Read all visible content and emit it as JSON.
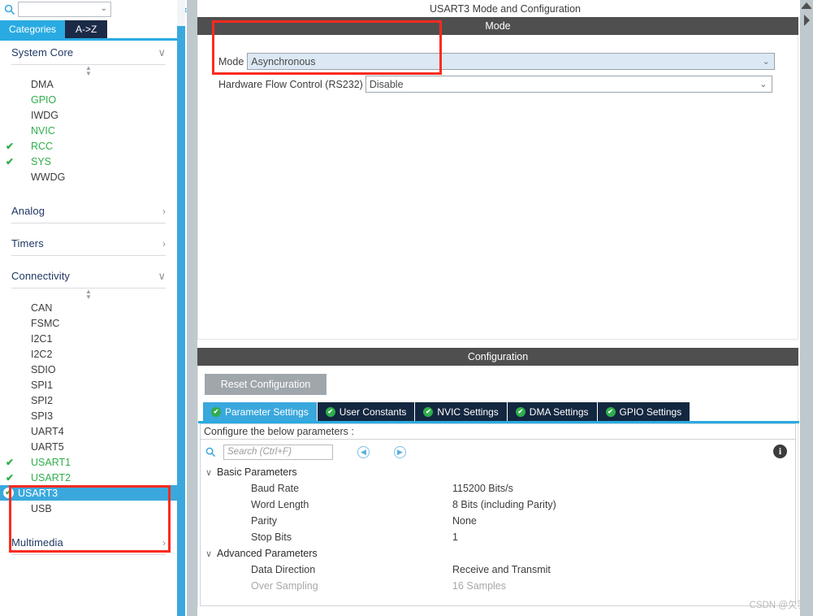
{
  "sidebar": {
    "search": {
      "value": "",
      "placeholder": ""
    },
    "search_icon": "search-icon",
    "gear_icon": "gear-icon",
    "tabs": [
      {
        "label": "Categories",
        "active": true
      },
      {
        "label": "A->Z",
        "active": false
      }
    ],
    "groups": [
      {
        "name": "System Core",
        "expanded": true,
        "arrow": "∨",
        "items": [
          {
            "label": "DMA",
            "checked": false,
            "green": false,
            "selected": false
          },
          {
            "label": "GPIO",
            "checked": false,
            "green": true,
            "selected": false
          },
          {
            "label": "IWDG",
            "checked": false,
            "green": false,
            "selected": false
          },
          {
            "label": "NVIC",
            "checked": false,
            "green": true,
            "selected": false
          },
          {
            "label": "RCC",
            "checked": true,
            "green": true,
            "selected": false
          },
          {
            "label": "SYS",
            "checked": true,
            "green": true,
            "selected": false
          },
          {
            "label": "WWDG",
            "checked": false,
            "green": false,
            "selected": false
          }
        ]
      },
      {
        "name": "Analog",
        "expanded": false,
        "arrow": "›",
        "items": []
      },
      {
        "name": "Timers",
        "expanded": false,
        "arrow": "›",
        "items": []
      },
      {
        "name": "Connectivity",
        "expanded": true,
        "arrow": "∨",
        "items": [
          {
            "label": "CAN",
            "checked": false,
            "green": false,
            "selected": false
          },
          {
            "label": "FSMC",
            "checked": false,
            "green": false,
            "selected": false
          },
          {
            "label": "I2C1",
            "checked": false,
            "green": false,
            "selected": false
          },
          {
            "label": "I2C2",
            "checked": false,
            "green": false,
            "selected": false
          },
          {
            "label": "SDIO",
            "checked": false,
            "green": false,
            "selected": false
          },
          {
            "label": "SPI1",
            "checked": false,
            "green": false,
            "selected": false
          },
          {
            "label": "SPI2",
            "checked": false,
            "green": false,
            "selected": false
          },
          {
            "label": "SPI3",
            "checked": false,
            "green": false,
            "selected": false
          },
          {
            "label": "UART4",
            "checked": false,
            "green": false,
            "selected": false
          },
          {
            "label": "UART5",
            "checked": false,
            "green": false,
            "selected": false
          },
          {
            "label": "USART1",
            "checked": true,
            "green": true,
            "selected": false
          },
          {
            "label": "USART2",
            "checked": true,
            "green": true,
            "selected": false
          },
          {
            "label": "USART3",
            "checked": true,
            "green": true,
            "selected": true
          },
          {
            "label": "USB",
            "checked": false,
            "green": false,
            "selected": false
          }
        ]
      },
      {
        "name": "Multimedia",
        "expanded": false,
        "arrow": "›",
        "items": []
      }
    ]
  },
  "right": {
    "page_title": "USART3 Mode and Configuration",
    "mode_section": {
      "band": "Mode",
      "fields": [
        {
          "label": "Mode",
          "value": "Asynchronous",
          "style": "active"
        },
        {
          "label": "Hardware Flow Control (RS232)",
          "value": "Disable",
          "style": "plain"
        }
      ]
    },
    "config_section": {
      "band": "Configuration",
      "reset_label": "Reset Configuration",
      "tabs": [
        {
          "label": "Parameter Settings",
          "active": true
        },
        {
          "label": "User Constants",
          "active": false
        },
        {
          "label": "NVIC Settings",
          "active": false
        },
        {
          "label": "DMA Settings",
          "active": false
        },
        {
          "label": "GPIO Settings",
          "active": false
        }
      ],
      "configure_hint": "Configure the below parameters :",
      "search": {
        "value": "",
        "placeholder": "Search (Ctrl+F)"
      },
      "nav_prev_icon": "chevron-left-circle-icon",
      "nav_next_icon": "chevron-right-circle-icon",
      "info_icon": "info-icon",
      "param_groups": [
        {
          "name": "Basic Parameters",
          "arrow": "∨",
          "rows": [
            {
              "name": "Baud Rate",
              "value": "115200 Bits/s",
              "dim": false
            },
            {
              "name": "Word Length",
              "value": "8 Bits (including Parity)",
              "dim": false
            },
            {
              "name": "Parity",
              "value": "None",
              "dim": false
            },
            {
              "name": "Stop Bits",
              "value": "1",
              "dim": false
            }
          ]
        },
        {
          "name": "Advanced Parameters",
          "arrow": "∨",
          "rows": [
            {
              "name": "Data Direction",
              "value": "Receive and Transmit",
              "dim": false
            },
            {
              "name": "Over Sampling",
              "value": "16 Samples",
              "dim": true
            }
          ]
        }
      ]
    },
    "collapse_arrow_icon": "double-chevron-up-icon"
  },
  "watermark": "CSDN @欠羽",
  "colors": {
    "accent_blue": "#3aa8dd",
    "tab_blue": "#29abe2",
    "tab_navy": "#132740",
    "band_gray": "#4f4f4f",
    "green": "#2fae4b",
    "annotation_red": "#fb2b1f",
    "select_active_bg": "#dce9f5"
  }
}
